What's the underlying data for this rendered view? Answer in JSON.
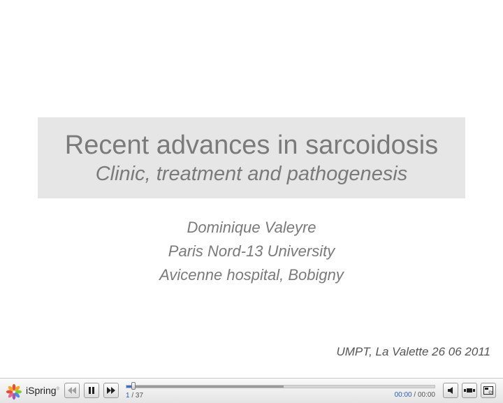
{
  "slide": {
    "title": "Recent advances in sarcoidosis",
    "subtitle": "Clinic, treatment and pathogenesis",
    "authors": [
      "Dominique Valeyre",
      "Paris Nord-13 University",
      "Avicenne hospital, Bobigny"
    ],
    "footer_note": "UMPT, La Valette 26 06 2011"
  },
  "player": {
    "logo_text": "iSpring",
    "logo_mark": "®",
    "slide_current": "1",
    "slide_separator": " / ",
    "slide_total": "37",
    "time_current": "00:00",
    "time_separator": " / ",
    "time_total": "00:00",
    "progress_played_fraction": 0.02,
    "progress_loaded_fraction": 0.51,
    "icons": {
      "logo": "ispring-flower-icon",
      "previous": "rewind-icon",
      "pause": "pause-icon",
      "next": "fast-forward-icon",
      "volume": "volume-icon",
      "layout": "layout-toggle-icon",
      "fullscreen": "fullscreen-icon"
    },
    "colors": {
      "accent": "#3b6fc8",
      "logo": [
        "#e94b35",
        "#f5a623",
        "#7ed321",
        "#4a90e2",
        "#9b59b6",
        "#f06292"
      ]
    }
  }
}
